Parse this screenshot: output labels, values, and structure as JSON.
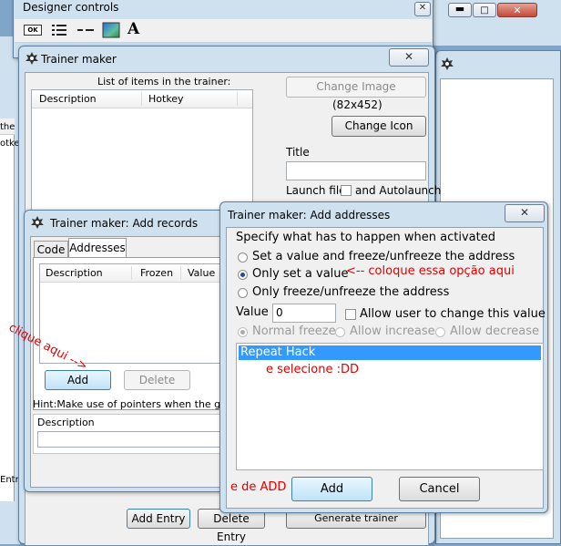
{
  "designer": {
    "title": "Designer controls",
    "tools": [
      "button-tool-icon",
      "list-tool-icon",
      "line-tool-icon",
      "image-tool-icon",
      "text-tool-icon"
    ],
    "tool_ok_label": "OK",
    "tool_text_label": "A"
  },
  "side_left": {
    "text1": "the",
    "text2": "otkey",
    "text3": "Entry"
  },
  "trainer_maker": {
    "title": "Trainer maker",
    "list_label": "List of items in the trainer:",
    "columns": [
      "Description",
      "Hotkey"
    ],
    "change_image": "Change Image",
    "image_size": "(82x452)",
    "change_icon": "Change Icon",
    "title_label": "Title",
    "launch_file": "Launch file:",
    "autolaunch": "and Autolaunch",
    "add_entry": "Add Entry",
    "delete_entry": "Delete Entry",
    "generate": "Generate trainer"
  },
  "add_records": {
    "title": "Trainer maker: Add records",
    "tabs": [
      "Code",
      "Addresses"
    ],
    "columns": [
      "Description",
      "Frozen",
      "Value"
    ],
    "add": "Add",
    "delete": "Delete",
    "hint": "Hint:Make use of pointers when the game u",
    "desc_label": "Description"
  },
  "add_addresses": {
    "title": "Trainer maker: Add addresses",
    "specify": "Specify  what has to happen when activated",
    "options": [
      "Set a value and freeze/unfreeze the address",
      "Only set a value",
      "Only freeze/unfreeze the address"
    ],
    "selected_option": "Only set a value",
    "value_label": "Value",
    "value": "0",
    "allow_change": "Allow user to change this value",
    "normal_freeze": "Normal freeze",
    "allow_increase": "Allow increase",
    "allow_decrease": "Allow decrease",
    "list_item": "Repeat Hack",
    "add": "Add",
    "cancel": "Cancel"
  },
  "annotations": {
    "option_note": "<-- coloque essa opção aqui",
    "click_here": "clique aqui -->",
    "select_note": "e selecione :DD",
    "add_note": "e de ADD"
  },
  "colors": {
    "annotation": "#e00000",
    "selection": "#3399ff",
    "close": "#c75050"
  }
}
